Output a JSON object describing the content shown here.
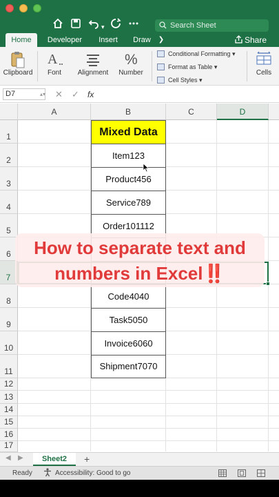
{
  "titlebar": {
    "search_placeholder": "Search Sheet",
    "icons": [
      "home-icon",
      "save-icon",
      "undo-icon",
      "redo-icon",
      "more-icon"
    ]
  },
  "tabs": {
    "items": [
      "Home",
      "Developer",
      "Insert",
      "Draw"
    ],
    "overflow": "❯",
    "share_label": "Share",
    "active": "Home"
  },
  "ribbon": {
    "clipboard": "Clipboard",
    "font": "Font",
    "alignment": "Alignment",
    "number": "Number",
    "conditional_formatting": "Conditional Formatting",
    "format_as_table": "Format as Table",
    "cell_styles": "Cell Styles",
    "cells": "Cells"
  },
  "formula_bar": {
    "name_box": "D7",
    "fx": "fx",
    "cancel": "✕",
    "confirm": "✓"
  },
  "grid": {
    "columns": [
      "A",
      "B",
      "C",
      "D"
    ],
    "rows": [
      "1",
      "2",
      "3",
      "4",
      "5",
      "6",
      "7",
      "8",
      "9",
      "10",
      "11",
      "12",
      "13",
      "14",
      "15",
      "16",
      "17"
    ],
    "selected_column": "D",
    "selected_row": "7",
    "header_cell": "Mixed Data",
    "values": [
      "Item123",
      "Product456",
      "Service789",
      "Order101112",
      "",
      "",
      "Code4040",
      "Task5050",
      "Invoice6060",
      "Shipment7070"
    ],
    "header_color": "#ffff00"
  },
  "overlay": {
    "line1": "How to separate text and",
    "line2": "numbers in Excel‼️",
    "color": "#e03a3a"
  },
  "sheets": {
    "active": "Sheet2",
    "add": "+"
  },
  "status": {
    "ready": "Ready",
    "accessibility": "Accessibility: Good to go"
  },
  "accent_color": "#1e7145"
}
